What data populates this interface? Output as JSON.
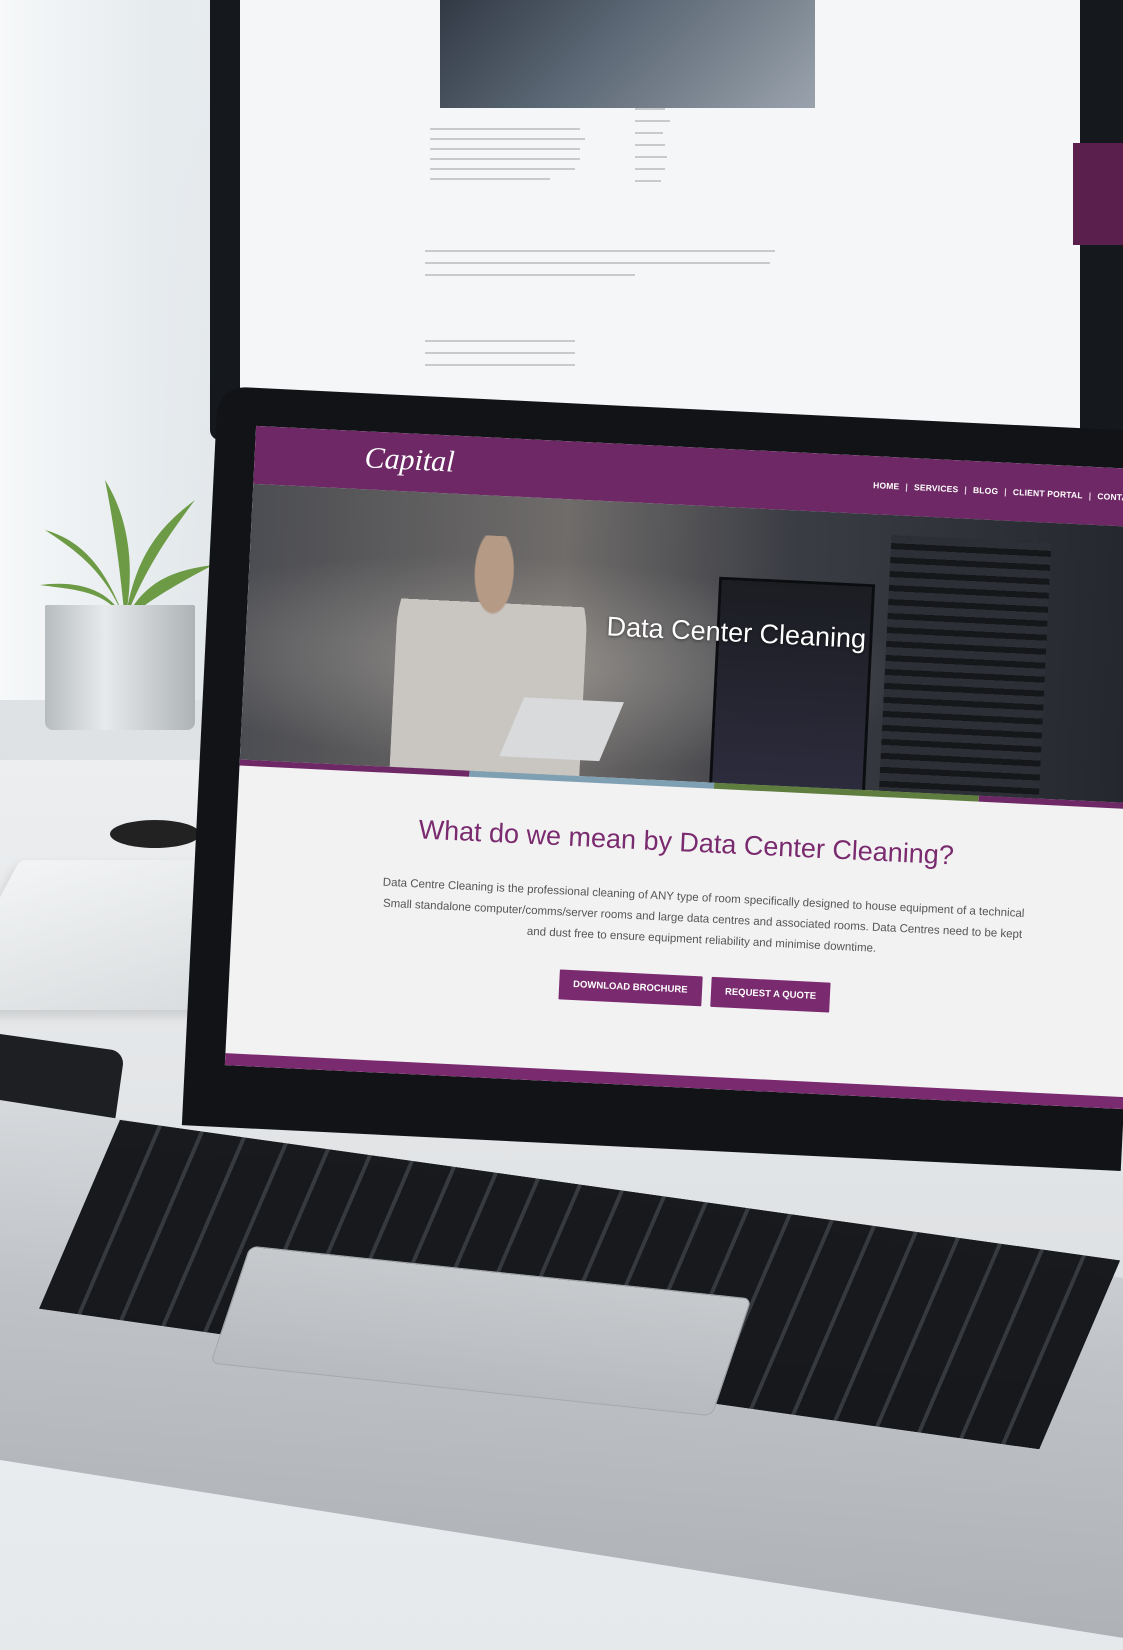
{
  "site": {
    "logo": "Capital",
    "nav": [
      {
        "label": "HOME"
      },
      {
        "label": "SERVICES"
      },
      {
        "label": "BLOG"
      },
      {
        "label": "CLIENT PORTAL"
      },
      {
        "label": "CONTACT"
      }
    ],
    "hero_title": "Data Center Cleaning",
    "heading": "What do we mean by Data Center Cleaning?",
    "body_lines": [
      "Data Centre Cleaning is the professional cleaning of ANY type of room specifically designed to house equipment of a technical",
      "Small standalone computer/comms/server rooms and large data centres and associated rooms. Data Centres need to be kept",
      "and dust free to ensure equipment reliability and minimise downtime."
    ],
    "buttons": {
      "download": "DOWNLOAD BROCHURE",
      "quote": "REQUEST A QUOTE"
    }
  },
  "colors": {
    "brand_purple": "#7a2a6e",
    "bar_segments": [
      "#6e2865",
      "#7fa0b3",
      "#5e7d3f",
      "#6e2865"
    ]
  },
  "icons": {
    "plant": "plant-icon",
    "side_panel": "side-panel"
  }
}
